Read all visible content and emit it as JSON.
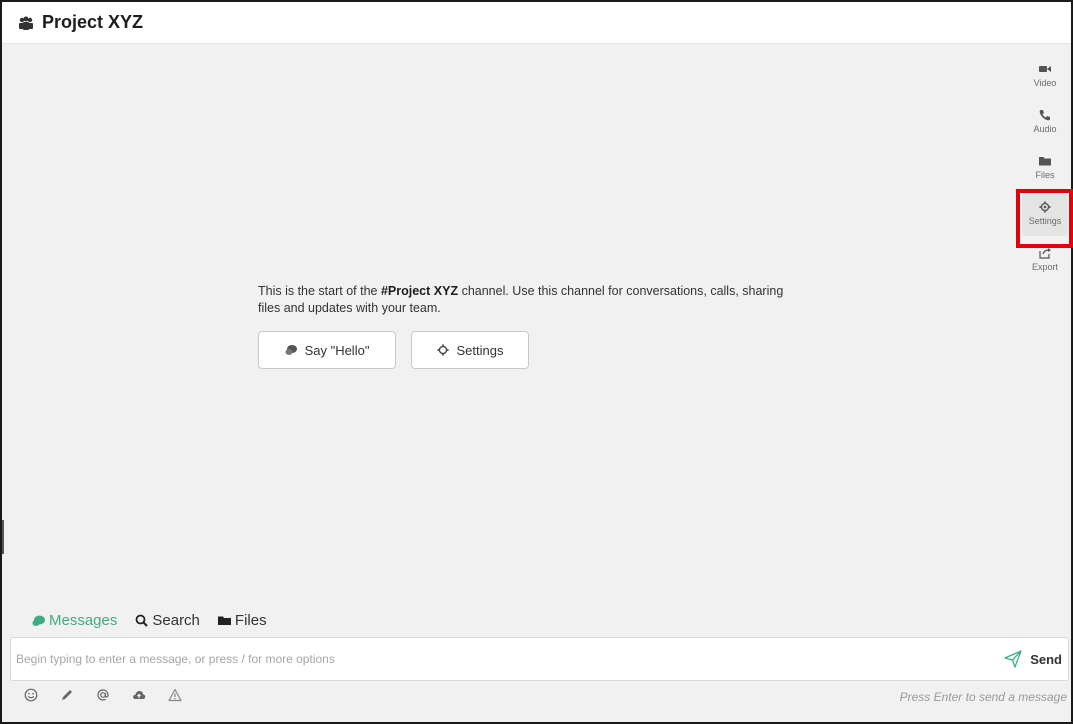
{
  "header": {
    "title": "Project XYZ",
    "icon": "team-icon"
  },
  "right_bar": {
    "items": [
      {
        "label": "Video",
        "icon": "video-icon"
      },
      {
        "label": "Audio",
        "icon": "phone-icon"
      },
      {
        "label": "Files",
        "icon": "folder-icon"
      },
      {
        "label": "Settings",
        "icon": "gear-icon"
      },
      {
        "label": "Export",
        "icon": "export-icon"
      }
    ]
  },
  "intro": {
    "prefix": "This is the start of the ",
    "channel": "#Project XYZ",
    "suffix": " channel. Use this channel for conversations, calls, sharing files and updates with your team."
  },
  "buttons": {
    "say_hello": "Say \"Hello\"",
    "settings": "Settings"
  },
  "tabs": [
    {
      "label": "Messages",
      "icon": "chat-icon",
      "active": true
    },
    {
      "label": "Search",
      "icon": "search-icon",
      "active": false
    },
    {
      "label": "Files",
      "icon": "folder-icon",
      "active": false
    }
  ],
  "composer": {
    "placeholder": "Begin typing to enter a message, or press / for more options",
    "value": "",
    "send_label": "Send"
  },
  "toolbar": {
    "tools": [
      "emoji-icon",
      "pencil-icon",
      "at-icon",
      "cloud-upload-icon",
      "warning-icon"
    ],
    "hint": "Press Enter to send a message"
  },
  "colors": {
    "accent": "#3cae82",
    "highlight": "#e3000b"
  }
}
